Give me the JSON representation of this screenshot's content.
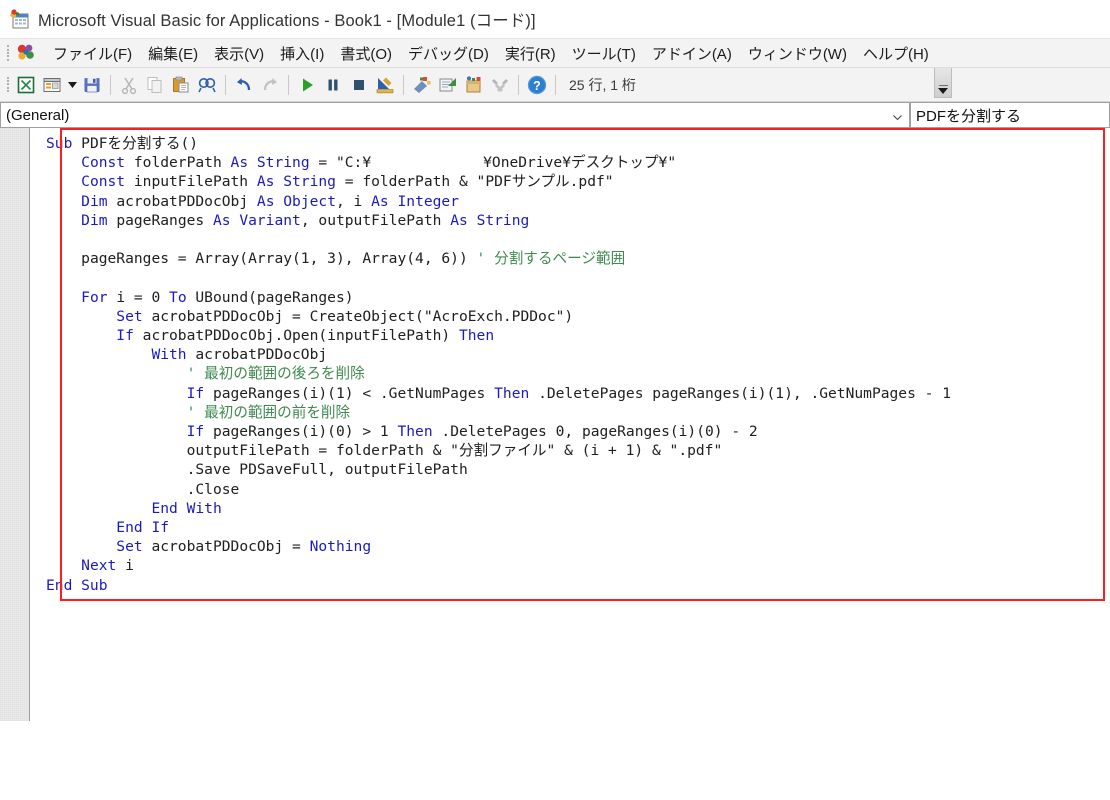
{
  "window": {
    "title": "Microsoft Visual Basic for Applications - Book1 - [Module1 (コード)]",
    "app_icon": "vba-app-icon"
  },
  "menubar": {
    "logo_icon": "vba-logo-icon",
    "items": [
      {
        "label": "ファイル(F)",
        "accel": "F",
        "name": "menu-file"
      },
      {
        "label": "編集(E)",
        "accel": "E",
        "name": "menu-edit"
      },
      {
        "label": "表示(V)",
        "accel": "V",
        "name": "menu-view"
      },
      {
        "label": "挿入(I)",
        "accel": "I",
        "name": "menu-insert"
      },
      {
        "label": "書式(O)",
        "accel": "O",
        "name": "menu-format"
      },
      {
        "label": "デバッグ(D)",
        "accel": "D",
        "name": "menu-debug"
      },
      {
        "label": "実行(R)",
        "accel": "R",
        "name": "menu-run"
      },
      {
        "label": "ツール(T)",
        "accel": "T",
        "name": "menu-tools"
      },
      {
        "label": "アドイン(A)",
        "accel": "A",
        "name": "menu-addins"
      },
      {
        "label": "ウィンドウ(W)",
        "accel": "W",
        "name": "menu-window"
      },
      {
        "label": "ヘルプ(H)",
        "accel": "H",
        "name": "menu-help"
      }
    ]
  },
  "toolbar": {
    "status": "25 行, 1 桁",
    "buttons": [
      {
        "name": "view-excel-icon",
        "title": "表示 Microsoft Excel"
      },
      {
        "name": "insert-userform-icon",
        "title": "ユーザーフォームの挿入"
      },
      {
        "name": "insert-dropdown-caret-icon",
        "title": "挿入の一覧"
      },
      {
        "name": "save-icon",
        "title": "Book1 の上書き保存"
      },
      {
        "name": "cut-icon",
        "title": "切り取り"
      },
      {
        "name": "copy-icon",
        "title": "コピー"
      },
      {
        "name": "paste-icon",
        "title": "貼り付け"
      },
      {
        "name": "find-icon",
        "title": "検索"
      },
      {
        "name": "undo-icon",
        "title": "元に戻す"
      },
      {
        "name": "redo-icon",
        "title": "やり直し"
      },
      {
        "name": "run-icon",
        "title": "Sub/ユーザーフォームの実行"
      },
      {
        "name": "pause-icon",
        "title": "中断"
      },
      {
        "name": "stop-icon",
        "title": "リセット"
      },
      {
        "name": "design-mode-icon",
        "title": "デザインモード"
      },
      {
        "name": "project-explorer-icon",
        "title": "プロジェクトエクスプローラー"
      },
      {
        "name": "properties-window-icon",
        "title": "プロパティウィンドウ"
      },
      {
        "name": "object-browser-icon",
        "title": "オブジェクトブラウザー"
      },
      {
        "name": "toolbox-icon",
        "title": "ツールボックス"
      },
      {
        "name": "help-icon",
        "title": "ヘルプ"
      }
    ],
    "overflow_name": "toolbar-overflow-button"
  },
  "combos": {
    "object": {
      "value": "(General)",
      "name": "object-combo"
    },
    "procedure": {
      "value": "PDFを分割する",
      "name": "procedure-combo"
    }
  },
  "code": {
    "redacted_placeholder": "",
    "lines": [
      {
        "indent": 0,
        "segments": [
          {
            "t": "Sub ",
            "c": "kw"
          },
          {
            "t": "PDFを分割する()",
            "c": ""
          }
        ]
      },
      {
        "indent": 1,
        "segments": [
          {
            "t": "Const ",
            "c": "kw"
          },
          {
            "t": "folderPath ",
            "c": ""
          },
          {
            "t": "As String",
            "c": "kw"
          },
          {
            "t": " = \"C:¥",
            "c": ""
          },
          {
            "t": "REDACT",
            "c": "redact"
          },
          {
            "t": "¥OneDrive¥デスクトップ¥\"",
            "c": ""
          }
        ]
      },
      {
        "indent": 1,
        "segments": [
          {
            "t": "Const ",
            "c": "kw"
          },
          {
            "t": "inputFilePath ",
            "c": ""
          },
          {
            "t": "As String",
            "c": "kw"
          },
          {
            "t": " = folderPath & \"PDFサンプル.pdf\"",
            "c": ""
          }
        ]
      },
      {
        "indent": 1,
        "segments": [
          {
            "t": "Dim ",
            "c": "kw"
          },
          {
            "t": "acrobatPDDocObj ",
            "c": ""
          },
          {
            "t": "As Object",
            "c": "kw"
          },
          {
            "t": ", i ",
            "c": ""
          },
          {
            "t": "As Integer",
            "c": "kw"
          }
        ]
      },
      {
        "indent": 1,
        "segments": [
          {
            "t": "Dim ",
            "c": "kw"
          },
          {
            "t": "pageRanges ",
            "c": ""
          },
          {
            "t": "As Variant",
            "c": "kw"
          },
          {
            "t": ", outputFilePath ",
            "c": ""
          },
          {
            "t": "As String",
            "c": "kw"
          }
        ]
      },
      {
        "indent": 0,
        "segments": []
      },
      {
        "indent": 1,
        "segments": [
          {
            "t": "pageRanges = Array(Array(1, 3), Array(4, 6)) ",
            "c": ""
          },
          {
            "t": "' 分割するページ範囲",
            "c": "cm"
          }
        ]
      },
      {
        "indent": 0,
        "segments": []
      },
      {
        "indent": 1,
        "segments": [
          {
            "t": "For ",
            "c": "kw"
          },
          {
            "t": "i = 0 ",
            "c": ""
          },
          {
            "t": "To ",
            "c": "kw"
          },
          {
            "t": "UBound(pageRanges)",
            "c": ""
          }
        ]
      },
      {
        "indent": 2,
        "segments": [
          {
            "t": "Set ",
            "c": "kw"
          },
          {
            "t": "acrobatPDDocObj = CreateObject(\"AcroExch.PDDoc\")",
            "c": ""
          }
        ]
      },
      {
        "indent": 2,
        "segments": [
          {
            "t": "If ",
            "c": "kw"
          },
          {
            "t": "acrobatPDDocObj.Open(inputFilePath) ",
            "c": ""
          },
          {
            "t": "Then",
            "c": "kw"
          }
        ]
      },
      {
        "indent": 3,
        "segments": [
          {
            "t": "With ",
            "c": "kw"
          },
          {
            "t": "acrobatPDDocObj",
            "c": ""
          }
        ]
      },
      {
        "indent": 4,
        "segments": [
          {
            "t": "' 最初の範囲の後ろを削除",
            "c": "cm"
          }
        ]
      },
      {
        "indent": 4,
        "segments": [
          {
            "t": "If ",
            "c": "kw"
          },
          {
            "t": "pageRanges(i)(1) < .GetNumPages ",
            "c": ""
          },
          {
            "t": "Then",
            "c": "kw"
          },
          {
            "t": " .DeletePages pageRanges(i)(1), .GetNumPages - 1",
            "c": ""
          }
        ]
      },
      {
        "indent": 4,
        "segments": [
          {
            "t": "' 最初の範囲の前を削除",
            "c": "cm"
          }
        ]
      },
      {
        "indent": 4,
        "segments": [
          {
            "t": "If ",
            "c": "kw"
          },
          {
            "t": "pageRanges(i)(0) > 1 ",
            "c": ""
          },
          {
            "t": "Then",
            "c": "kw"
          },
          {
            "t": " .DeletePages 0, pageRanges(i)(0) - 2",
            "c": ""
          }
        ]
      },
      {
        "indent": 4,
        "segments": [
          {
            "t": "outputFilePath = folderPath & \"分割ファイル\" & (i + 1) & \".pdf\"",
            "c": ""
          }
        ]
      },
      {
        "indent": 4,
        "segments": [
          {
            "t": ".Save PDSaveFull, outputFilePath",
            "c": ""
          }
        ]
      },
      {
        "indent": 4,
        "segments": [
          {
            "t": ".Close",
            "c": ""
          }
        ]
      },
      {
        "indent": 3,
        "segments": [
          {
            "t": "End With",
            "c": "kw"
          }
        ]
      },
      {
        "indent": 2,
        "segments": [
          {
            "t": "End If",
            "c": "kw"
          }
        ]
      },
      {
        "indent": 2,
        "segments": [
          {
            "t": "Set ",
            "c": "kw"
          },
          {
            "t": "acrobatPDDocObj = ",
            "c": ""
          },
          {
            "t": "Nothing",
            "c": "kw"
          }
        ]
      },
      {
        "indent": 1,
        "segments": [
          {
            "t": "Next ",
            "c": "kw"
          },
          {
            "t": "i",
            "c": ""
          }
        ]
      },
      {
        "indent": 0,
        "segments": [
          {
            "t": "End Sub",
            "c": "kw"
          }
        ]
      }
    ]
  },
  "colors": {
    "keyword": "#1b1bbd",
    "comment": "#3f8a50",
    "text": "#202020",
    "highlight_box": "#ff1d1d",
    "chrome": "#f3f3f3"
  }
}
